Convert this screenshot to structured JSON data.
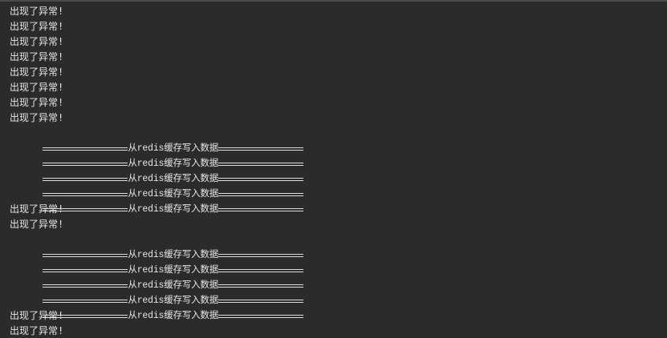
{
  "console": {
    "lines": [
      {
        "type": "error",
        "text": "出现了异常!"
      },
      {
        "type": "error",
        "text": "出现了异常!"
      },
      {
        "type": "error",
        "text": "出现了异常!"
      },
      {
        "type": "error",
        "text": "出现了异常!"
      },
      {
        "type": "error",
        "text": "出现了异常!"
      },
      {
        "type": "error",
        "text": "出现了异常!"
      },
      {
        "type": "error",
        "text": "出现了异常!"
      },
      {
        "type": "error",
        "text": "出现了异常!"
      },
      {
        "type": "redis",
        "text": "从redis缓存写入数据"
      },
      {
        "type": "redis",
        "text": "从redis缓存写入数据"
      },
      {
        "type": "redis",
        "text": "从redis缓存写入数据"
      },
      {
        "type": "redis",
        "text": "从redis缓存写入数据"
      },
      {
        "type": "redis",
        "text": "从redis缓存写入数据"
      },
      {
        "type": "error",
        "text": "出现了异常!"
      },
      {
        "type": "error",
        "text": "出现了异常!"
      },
      {
        "type": "redis",
        "text": "从redis缓存写入数据"
      },
      {
        "type": "redis",
        "text": "从redis缓存写入数据"
      },
      {
        "type": "redis",
        "text": "从redis缓存写入数据"
      },
      {
        "type": "redis",
        "text": "从redis缓存写入数据"
      },
      {
        "type": "redis",
        "text": "从redis缓存写入数据"
      },
      {
        "type": "error",
        "text": "出现了异常!"
      },
      {
        "type": "error",
        "text": "出现了异常!"
      }
    ]
  },
  "colors": {
    "background": "#2b2b2b",
    "text": "#e6e6e6"
  }
}
